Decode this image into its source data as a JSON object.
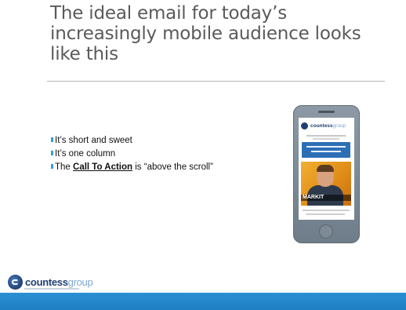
{
  "slide": {
    "title": "The ideal email for today’s increasingly mobile audience looks like this",
    "bullets": [
      {
        "text": "It’s short and sweet"
      },
      {
        "text": "It’s one column"
      },
      {
        "prefix": "The ",
        "emphasis": "Call To Action",
        "suffix": " is “above the scroll”"
      }
    ],
    "phone_preview": {
      "logo_bold": "countess",
      "logo_light": "group",
      "banner_text": "MARKIT"
    },
    "footer_logo": {
      "bold": "countess",
      "light": "group"
    },
    "colors": {
      "accent": "#3b9cd6",
      "footer_bar": "#1f7fc3",
      "title_text": "#5a5a5a",
      "brand_navy": "#1f3f73",
      "brand_light": "#7fa8d2"
    }
  }
}
